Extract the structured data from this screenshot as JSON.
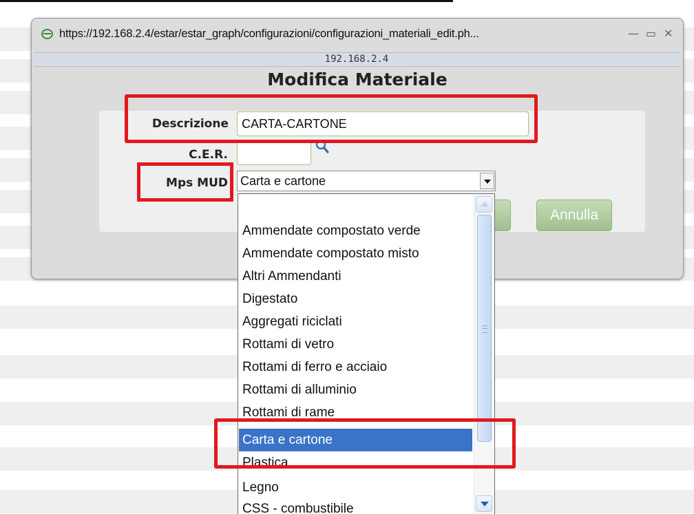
{
  "window": {
    "url": "https://192.168.2.4/estar/estar_graph/configurazioni/configurazioni_materiali_edit.ph...",
    "host": "192.168.2.4",
    "controls": {
      "minimize": "—",
      "maximize": "▭",
      "close": "✕"
    }
  },
  "form": {
    "title": "Modifica Materiale",
    "descrizione": {
      "label": "Descrizione",
      "value": "CARTA-CARTONE"
    },
    "cer": {
      "label": "C.E.R.",
      "value": ""
    },
    "mps_mud": {
      "label": "Mps MUD",
      "selected": "Carta e cartone"
    },
    "buttons": {
      "annulla": "Annulla"
    }
  },
  "dropdown": {
    "options": [
      "",
      "Ammendate compostato verde",
      "Ammendate compostato misto",
      "Altri Ammendanti",
      "Digestato",
      "Aggregati riciclati",
      "Rottami di vetro",
      "Rottami di ferro e acciaio",
      "Rottami di alluminio",
      "Rottami di rame",
      "Carta e cartone",
      "Plastica",
      "Legno",
      "CSS - combustibile"
    ],
    "selected_index": 10
  },
  "icons": {
    "browser": "ie-icon",
    "lookup": "search-icon"
  },
  "colors": {
    "highlight": "#e0191f",
    "selected_option": "#3a73c8",
    "button": "#9fbf8e"
  }
}
